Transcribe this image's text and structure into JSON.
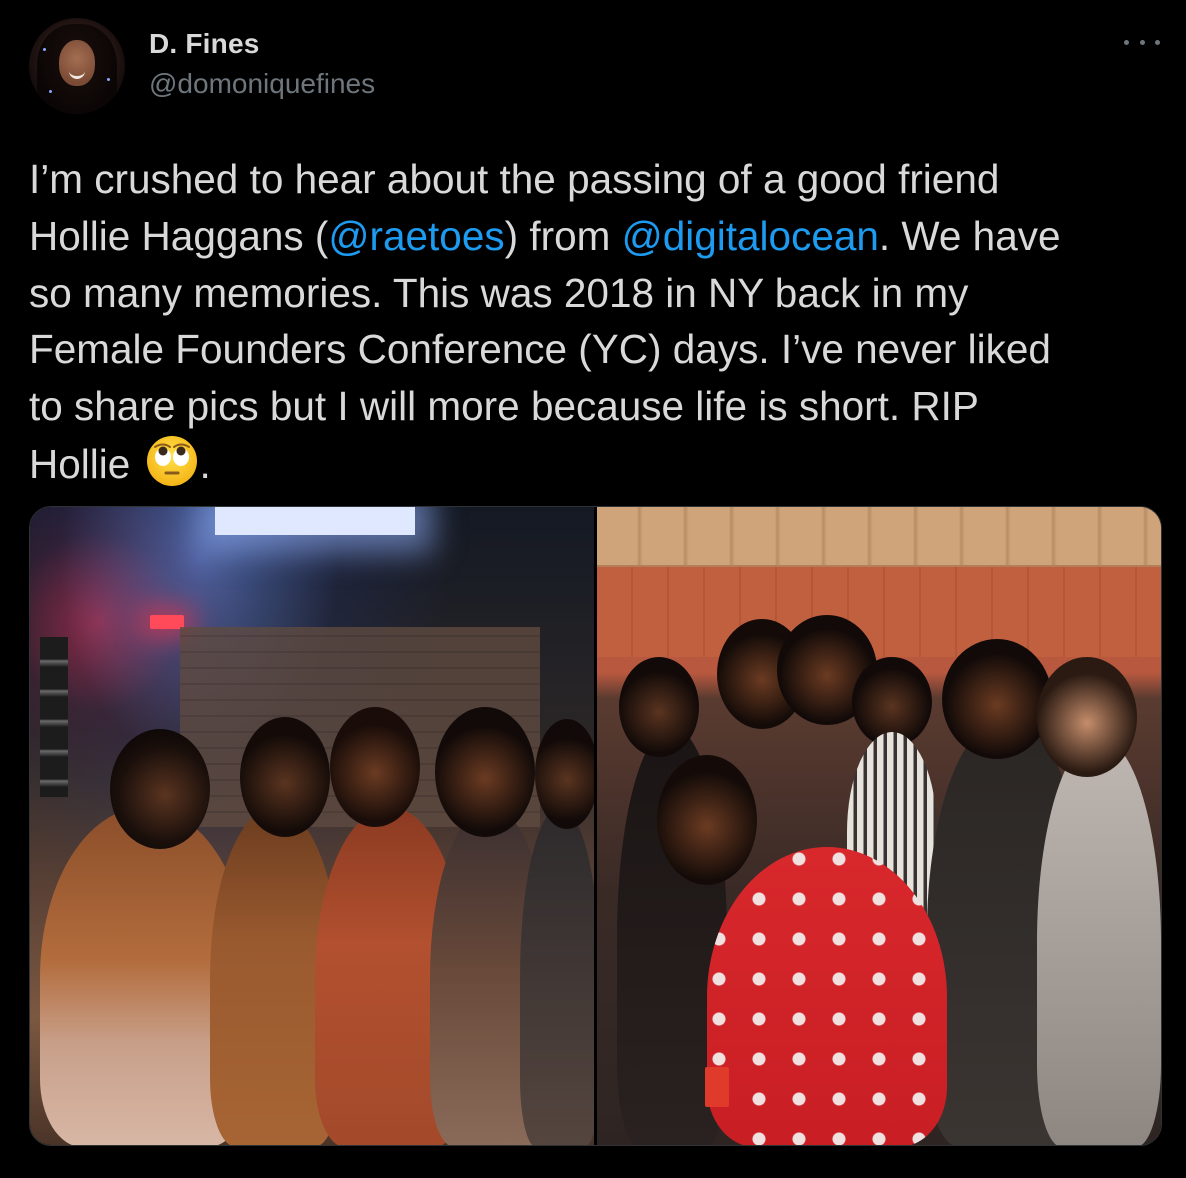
{
  "author": {
    "display_name": "D. Fines",
    "handle": "@domoniquefines"
  },
  "more_icon": "ellipsis-icon",
  "tweet": {
    "segments": [
      {
        "type": "text",
        "value": "I’m crushed to hear about the passing of a good friend\nHollie Haggans ("
      },
      {
        "type": "mention",
        "value": "@raetoes"
      },
      {
        "type": "text",
        "value": ") from "
      },
      {
        "type": "mention",
        "value": "@digitalocean"
      },
      {
        "type": "text",
        "value": ". We have\nso many memories. This was 2018 in NY back in my\nFemale Founders Conference (YC) days. I’ve never liked\nto share pics but I will more because life is short. RIP\nHollie "
      },
      {
        "type": "emoji",
        "value": "face-with-rolling-eyes-emoji"
      },
      {
        "type": "text",
        "value": "."
      }
    ]
  },
  "media": {
    "photos": [
      {
        "name": "photo-left"
      },
      {
        "name": "photo-right"
      }
    ]
  },
  "colors": {
    "background": "#000000",
    "text": "#d9d9d9",
    "secondary": "#6e767d",
    "link": "#1d9bf0"
  }
}
